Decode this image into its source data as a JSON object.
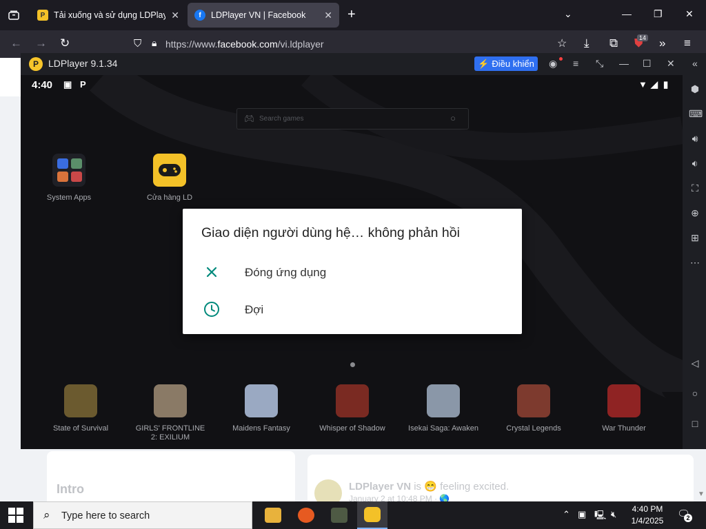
{
  "browser": {
    "tabs": [
      {
        "title": "Tải xuống và sử dụng LDPlayer",
        "favicon": "ldplayer-icon",
        "active": false
      },
      {
        "title": "LDPlayer VN | Facebook",
        "favicon": "facebook-icon",
        "active": true
      }
    ],
    "url_prefix": "https://www.",
    "url_domain": "facebook.com",
    "url_path": "/vi.ldplayer",
    "extension_badge": "14"
  },
  "facebook": {
    "intro_heading": "Intro",
    "post_author": "LDPlayer VN",
    "post_activity": "is 😁 feeling excited.",
    "post_time": "January 2 at 10:48 PM · 🌎"
  },
  "ldplayer": {
    "window_title": "LDPlayer 9.1.34",
    "control_button": "Điều khiển",
    "status_time": "4:40",
    "search_placeholder": "Search games",
    "desktop_apps": [
      {
        "label": "System Apps"
      },
      {
        "label": "Cửa hàng LD"
      }
    ],
    "recommended_games": [
      {
        "label": "State of Survival"
      },
      {
        "label": "GIRLS' FRONTLINE 2: EXILIUM"
      },
      {
        "label": "Maidens Fantasy"
      },
      {
        "label": "Whisper of Shadow"
      },
      {
        "label": "Isekai Saga: Awaken"
      },
      {
        "label": "Crystal Legends"
      },
      {
        "label": "War Thunder"
      }
    ]
  },
  "dialog": {
    "title": "Giao diện người dùng hệ… không phản hồi",
    "options": [
      {
        "label": "Đóng ứng dụng",
        "icon": "close-icon"
      },
      {
        "label": "Đợi",
        "icon": "clock-icon"
      }
    ],
    "accent_color": "#00897b"
  },
  "taskbar": {
    "search_placeholder": "Type here to search",
    "time": "4:40 PM",
    "date": "1/4/2025",
    "notification_count": "2"
  }
}
